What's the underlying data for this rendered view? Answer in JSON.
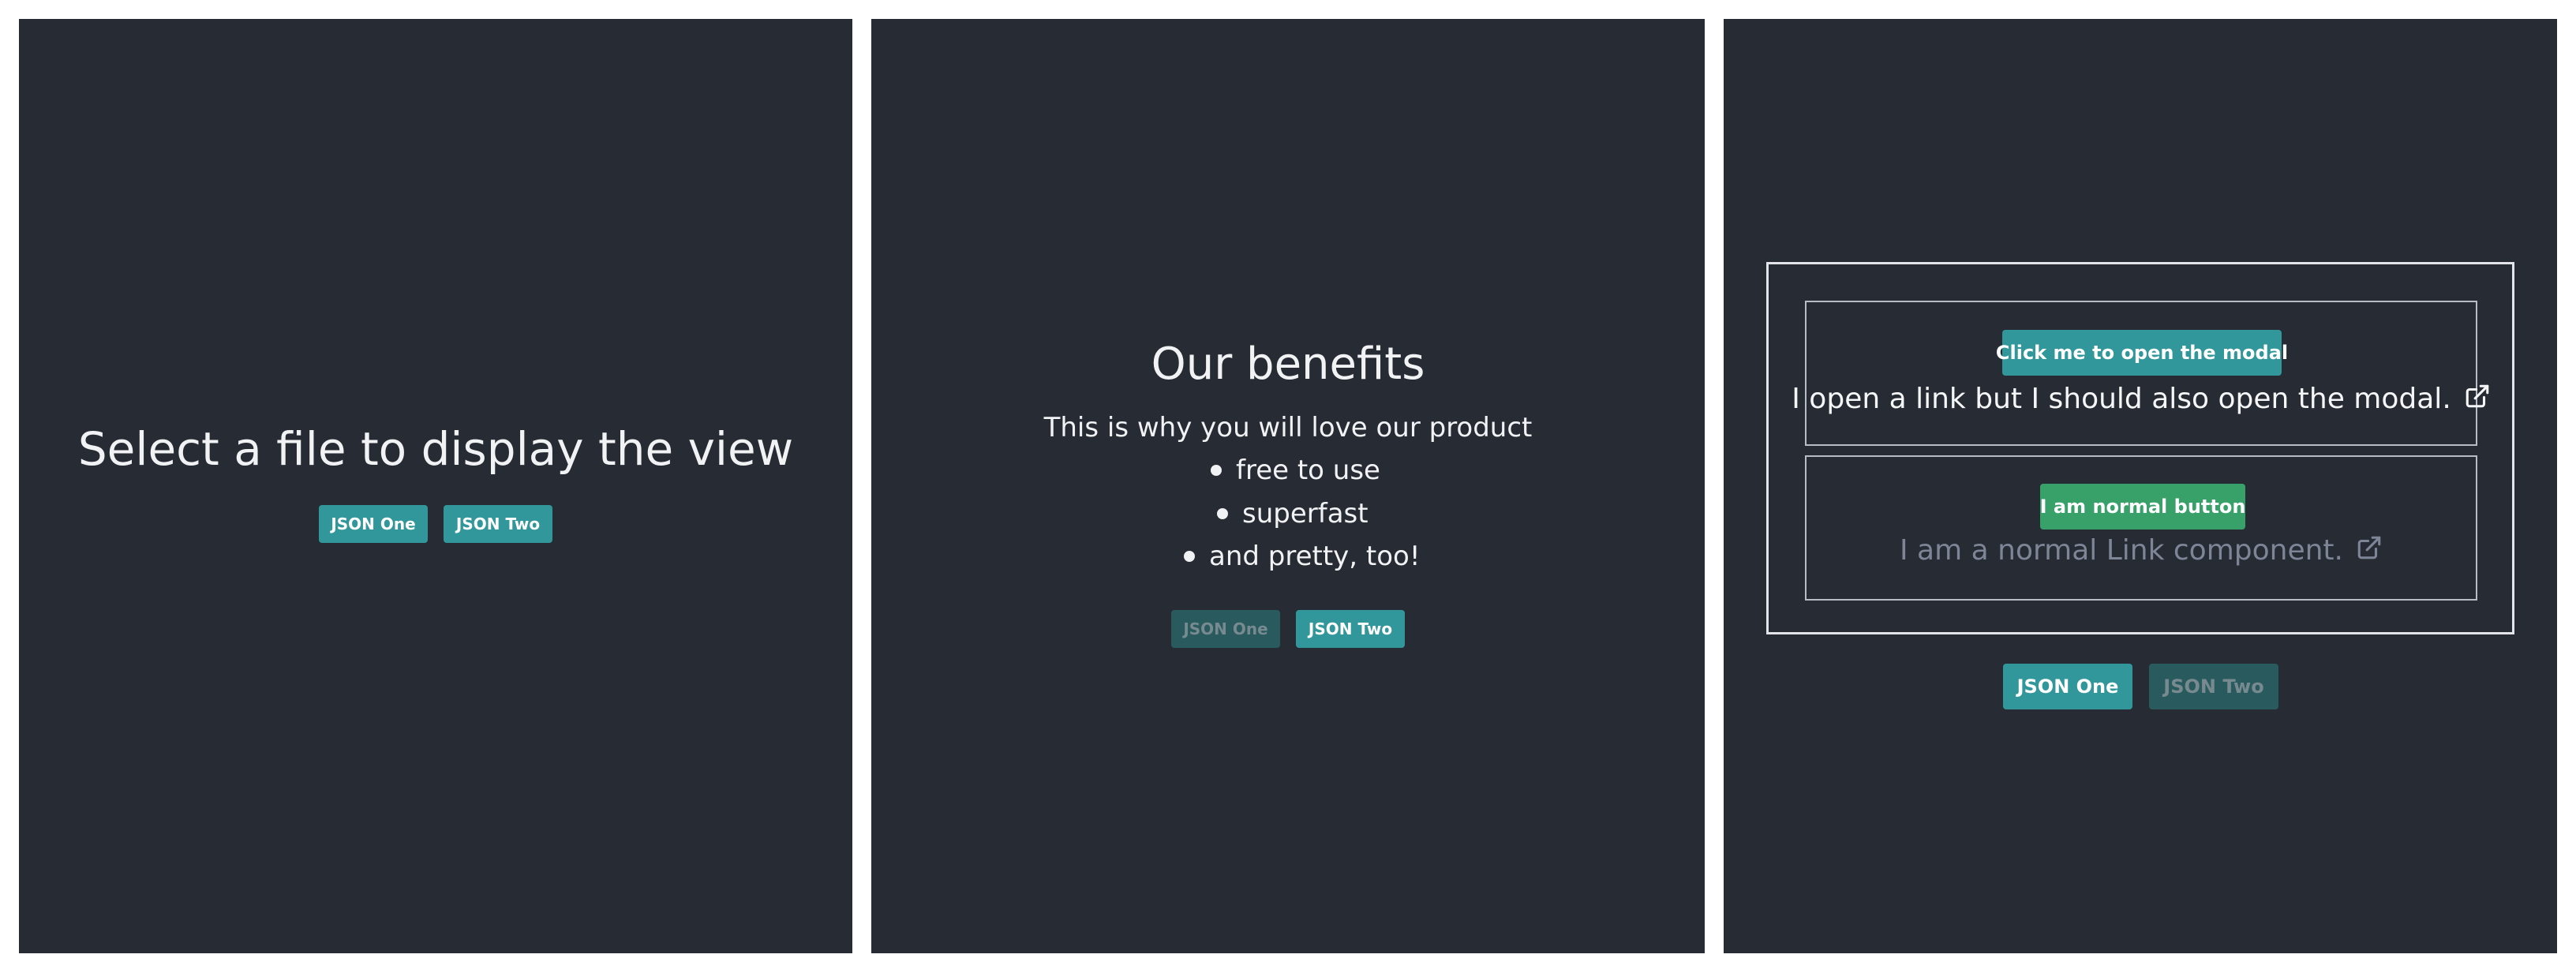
{
  "panel1": {
    "title": "Select a file to display the view",
    "buttons": {
      "json_one": {
        "label": "JSON One",
        "state": "active"
      },
      "json_two": {
        "label": "JSON Two",
        "state": "active"
      }
    }
  },
  "panel2": {
    "title": "Our benefits",
    "subtitle": "This is why you will love our product",
    "benefits": [
      "free to use",
      "superfast",
      "and pretty, too!"
    ],
    "buttons": {
      "json_one": {
        "label": "JSON One",
        "state": "disabled"
      },
      "json_two": {
        "label": "JSON Two",
        "state": "active"
      }
    }
  },
  "panel3": {
    "modal_button_label": "Click me to open the modal",
    "modal_link_text": "I open a link but I should also open the modal.",
    "normal_button_label": "I am normal button",
    "normal_link_text": "I am a normal Link component.",
    "link_icon": "external-link-icon",
    "buttons": {
      "json_one": {
        "label": "JSON One",
        "state": "active"
      },
      "json_two": {
        "label": "JSON Two",
        "state": "disabled"
      }
    }
  },
  "colors": {
    "panel_background": "#272b34",
    "teal_button": "#31979a",
    "teal_button_disabled": "#285a5e",
    "green_button": "#38a169",
    "muted_link": "#7d8596"
  }
}
